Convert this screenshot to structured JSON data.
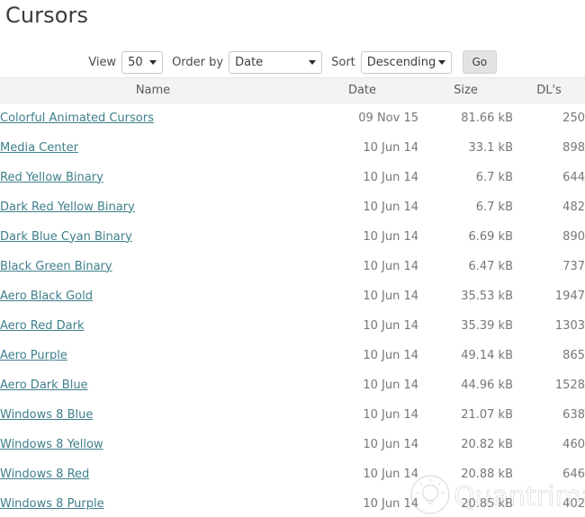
{
  "page": {
    "title": "Cursors"
  },
  "toolbar": {
    "view_label": "View",
    "view_value": "50",
    "order_by_label": "Order by",
    "order_by_value": "Date",
    "sort_label": "Sort",
    "sort_value": "Descending",
    "go_label": "Go"
  },
  "table": {
    "columns": [
      {
        "key": "name",
        "label": "Name"
      },
      {
        "key": "date",
        "label": "Date"
      },
      {
        "key": "size",
        "label": "Size"
      },
      {
        "key": "dl",
        "label": "DL's"
      }
    ],
    "rows": [
      {
        "name": "Colorful Animated Cursors",
        "date": "09 Nov 15",
        "size": "81.66 kB",
        "dl": "250"
      },
      {
        "name": "Media Center",
        "date": "10 Jun 14",
        "size": "33.1 kB",
        "dl": "898"
      },
      {
        "name": "Red Yellow Binary",
        "date": "10 Jun 14",
        "size": "6.7 kB",
        "dl": "644"
      },
      {
        "name": "Dark Red Yellow Binary",
        "date": "10 Jun 14",
        "size": "6.7 kB",
        "dl": "482"
      },
      {
        "name": "Dark Blue Cyan Binary",
        "date": "10 Jun 14",
        "size": "6.69 kB",
        "dl": "890"
      },
      {
        "name": "Black Green Binary",
        "date": "10 Jun 14",
        "size": "6.47 kB",
        "dl": "737"
      },
      {
        "name": "Aero Black Gold",
        "date": "10 Jun 14",
        "size": "35.53 kB",
        "dl": "1947"
      },
      {
        "name": "Aero Red Dark",
        "date": "10 Jun 14",
        "size": "35.39 kB",
        "dl": "1303"
      },
      {
        "name": "Aero Purple",
        "date": "10 Jun 14",
        "size": "49.14 kB",
        "dl": "865"
      },
      {
        "name": "Aero Dark Blue",
        "date": "10 Jun 14",
        "size": "44.96 kB",
        "dl": "1528"
      },
      {
        "name": "Windows 8 Blue",
        "date": "10 Jun 14",
        "size": "21.07 kB",
        "dl": "638"
      },
      {
        "name": "Windows 8 Yellow",
        "date": "10 Jun 14",
        "size": "20.82 kB",
        "dl": "460"
      },
      {
        "name": "Windows 8 Red",
        "date": "10 Jun 14",
        "size": "20.88 kB",
        "dl": "646"
      },
      {
        "name": "Windows 8 Purple",
        "date": "10 Jun 14",
        "size": "20.85 kB",
        "dl": "402"
      }
    ]
  },
  "watermark": {
    "text": "Quantrimang"
  },
  "colors": {
    "link": "#3f7f8c",
    "header_bg": "#f3f3f3",
    "text": "#777777",
    "title": "#3b3b3b"
  }
}
